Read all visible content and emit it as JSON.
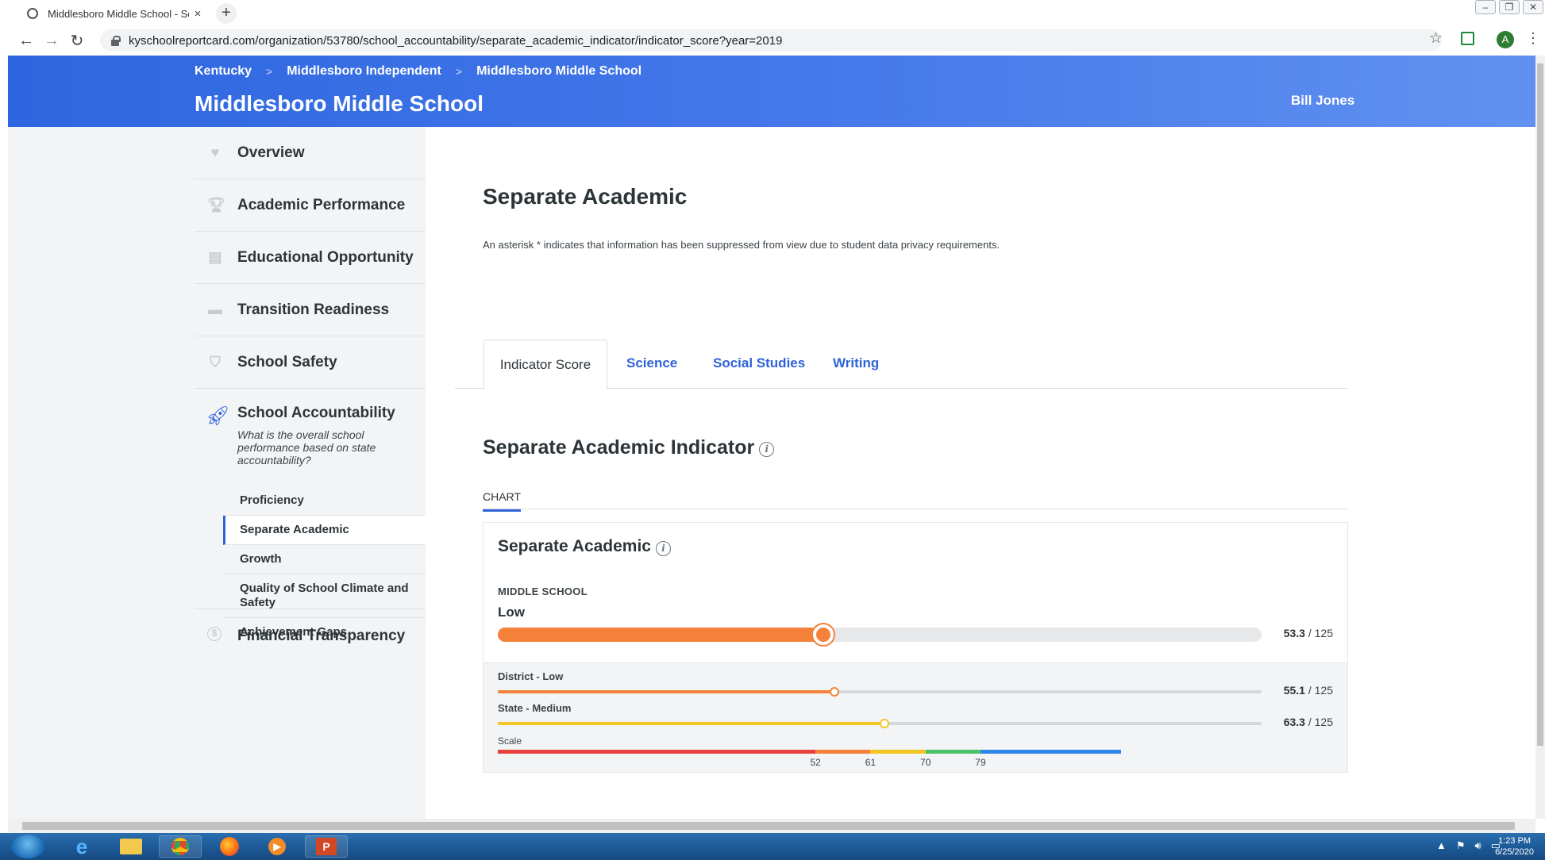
{
  "browser": {
    "tab_title": "Middlesboro Middle School - Se",
    "tab_close": "×",
    "new_tab": "+",
    "url": "kyschoolreportcard.com/organization/53780/school_accountability/separate_academic_indicator/indicator_score?year=2019",
    "back": "←",
    "forward": "→",
    "reload": "↻",
    "profile_initial": "A",
    "star": "☆",
    "menu": "⋮"
  },
  "header": {
    "breadcrumb": [
      "Kentucky",
      "Middlesboro Independent",
      "Middlesboro Middle School"
    ],
    "breadcrumb_sep": ">",
    "school_name": "Middlesboro Middle School",
    "user_name": "Bill Jones"
  },
  "sidebar": {
    "items": [
      {
        "label": "Overview",
        "icon": "heart-pulse-icon"
      },
      {
        "label": "Academic Performance",
        "icon": "trophy-icon"
      },
      {
        "label": "Educational Opportunity",
        "icon": "book-icon"
      },
      {
        "label": "Transition Readiness",
        "icon": "briefcase-icon"
      },
      {
        "label": "School Safety",
        "icon": "shield-icon"
      }
    ],
    "accountability": {
      "label": "School Accountability",
      "icon": "rocket-icon",
      "description": "What is the overall school performance based on state accountability?",
      "sub_items": [
        "Proficiency",
        "Separate Academic",
        "Growth",
        "Quality of School Climate and Safety",
        "Achievement Gaps"
      ],
      "active_index": 1
    },
    "financial": {
      "label": "Financial Transparency",
      "icon": "dollar-circle-icon"
    }
  },
  "main": {
    "title": "Separate Academic",
    "note": "An asterisk * indicates that information has been suppressed from view due to student data privacy requirements.",
    "tabs": [
      "Indicator Score",
      "Science",
      "Social Studies",
      "Writing"
    ],
    "active_tab": "Indicator Score",
    "section_title": "Separate Academic Indicator",
    "chart_tab": "CHART",
    "card": {
      "title": "Separate Academic",
      "level": "MIDDLE SCHOOL",
      "rating": "Low",
      "score_value": "53.3",
      "score_max": " / 125",
      "score": 53.3,
      "max": 125,
      "color": "#f4823a",
      "comparisons": [
        {
          "label": "District - Low",
          "value_text": "55.1",
          "max_text": " / 125",
          "value": 55.1,
          "color": "#f4823a"
        },
        {
          "label": "State - Medium",
          "value_text": "63.3",
          "max_text": " / 125",
          "value": 63.3,
          "color": "#f5c623"
        }
      ],
      "scale_label": "Scale",
      "scale_ticks": [
        52,
        61,
        70,
        79
      ],
      "scale_colors": [
        "#e8423f",
        "#f4823a",
        "#f5c623",
        "#4cc36a",
        "#2f86e8"
      ],
      "scale_max": 102
    }
  },
  "taskbar": {
    "time": "1:23 PM",
    "date": "6/25/2020"
  }
}
